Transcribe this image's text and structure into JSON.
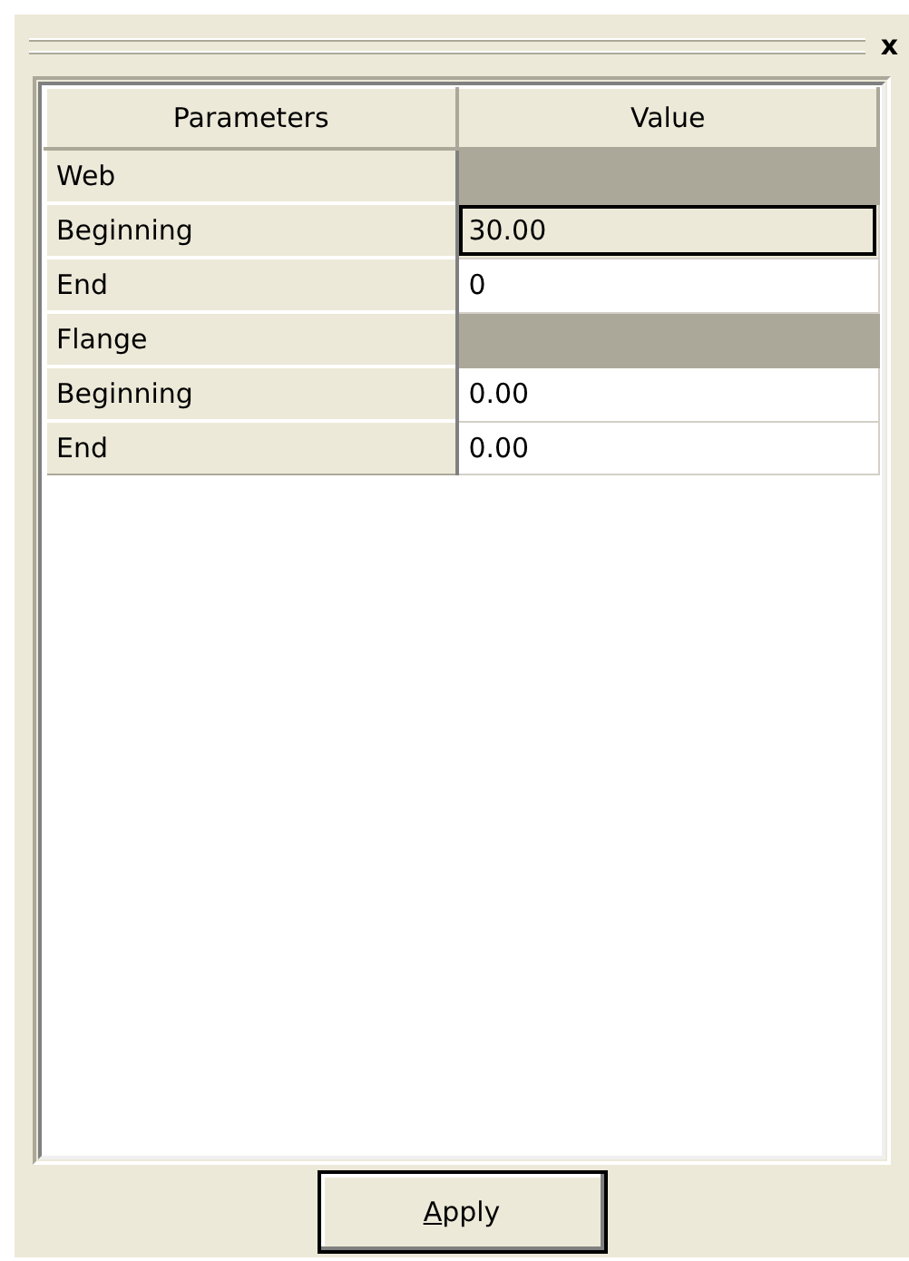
{
  "panel": {
    "close": "x"
  },
  "grid": {
    "columns": [
      "Parameters",
      "Value"
    ],
    "rows": [
      {
        "kind": "group",
        "label": "Web"
      },
      {
        "kind": "param",
        "label": "Beginning",
        "value": "30.00",
        "selected": true
      },
      {
        "kind": "param",
        "label": "End",
        "value": "0",
        "selected": false
      },
      {
        "kind": "group",
        "label": "Flange"
      },
      {
        "kind": "param",
        "label": "Beginning",
        "value": "0.00",
        "selected": false
      },
      {
        "kind": "param",
        "label": "End",
        "value": "0.00",
        "selected": false
      }
    ]
  },
  "apply_button": {
    "label": "Apply"
  }
}
